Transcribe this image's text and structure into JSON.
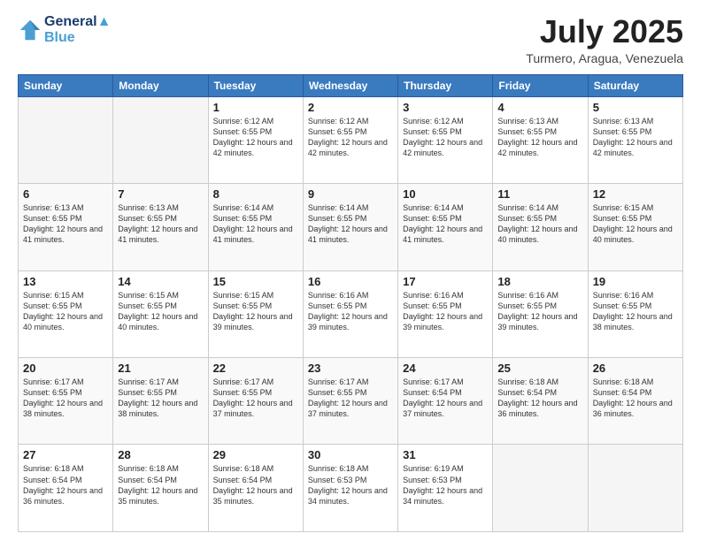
{
  "logo": {
    "line1": "General",
    "line2": "Blue"
  },
  "title": "July 2025",
  "location": "Turmero, Aragua, Venezuela",
  "weekdays": [
    "Sunday",
    "Monday",
    "Tuesday",
    "Wednesday",
    "Thursday",
    "Friday",
    "Saturday"
  ],
  "weeks": [
    [
      {
        "day": "",
        "info": ""
      },
      {
        "day": "",
        "info": ""
      },
      {
        "day": "1",
        "info": "Sunrise: 6:12 AM\nSunset: 6:55 PM\nDaylight: 12 hours and 42 minutes."
      },
      {
        "day": "2",
        "info": "Sunrise: 6:12 AM\nSunset: 6:55 PM\nDaylight: 12 hours and 42 minutes."
      },
      {
        "day": "3",
        "info": "Sunrise: 6:12 AM\nSunset: 6:55 PM\nDaylight: 12 hours and 42 minutes."
      },
      {
        "day": "4",
        "info": "Sunrise: 6:13 AM\nSunset: 6:55 PM\nDaylight: 12 hours and 42 minutes."
      },
      {
        "day": "5",
        "info": "Sunrise: 6:13 AM\nSunset: 6:55 PM\nDaylight: 12 hours and 42 minutes."
      }
    ],
    [
      {
        "day": "6",
        "info": "Sunrise: 6:13 AM\nSunset: 6:55 PM\nDaylight: 12 hours and 41 minutes."
      },
      {
        "day": "7",
        "info": "Sunrise: 6:13 AM\nSunset: 6:55 PM\nDaylight: 12 hours and 41 minutes."
      },
      {
        "day": "8",
        "info": "Sunrise: 6:14 AM\nSunset: 6:55 PM\nDaylight: 12 hours and 41 minutes."
      },
      {
        "day": "9",
        "info": "Sunrise: 6:14 AM\nSunset: 6:55 PM\nDaylight: 12 hours and 41 minutes."
      },
      {
        "day": "10",
        "info": "Sunrise: 6:14 AM\nSunset: 6:55 PM\nDaylight: 12 hours and 41 minutes."
      },
      {
        "day": "11",
        "info": "Sunrise: 6:14 AM\nSunset: 6:55 PM\nDaylight: 12 hours and 40 minutes."
      },
      {
        "day": "12",
        "info": "Sunrise: 6:15 AM\nSunset: 6:55 PM\nDaylight: 12 hours and 40 minutes."
      }
    ],
    [
      {
        "day": "13",
        "info": "Sunrise: 6:15 AM\nSunset: 6:55 PM\nDaylight: 12 hours and 40 minutes."
      },
      {
        "day": "14",
        "info": "Sunrise: 6:15 AM\nSunset: 6:55 PM\nDaylight: 12 hours and 40 minutes."
      },
      {
        "day": "15",
        "info": "Sunrise: 6:15 AM\nSunset: 6:55 PM\nDaylight: 12 hours and 39 minutes."
      },
      {
        "day": "16",
        "info": "Sunrise: 6:16 AM\nSunset: 6:55 PM\nDaylight: 12 hours and 39 minutes."
      },
      {
        "day": "17",
        "info": "Sunrise: 6:16 AM\nSunset: 6:55 PM\nDaylight: 12 hours and 39 minutes."
      },
      {
        "day": "18",
        "info": "Sunrise: 6:16 AM\nSunset: 6:55 PM\nDaylight: 12 hours and 39 minutes."
      },
      {
        "day": "19",
        "info": "Sunrise: 6:16 AM\nSunset: 6:55 PM\nDaylight: 12 hours and 38 minutes."
      }
    ],
    [
      {
        "day": "20",
        "info": "Sunrise: 6:17 AM\nSunset: 6:55 PM\nDaylight: 12 hours and 38 minutes."
      },
      {
        "day": "21",
        "info": "Sunrise: 6:17 AM\nSunset: 6:55 PM\nDaylight: 12 hours and 38 minutes."
      },
      {
        "day": "22",
        "info": "Sunrise: 6:17 AM\nSunset: 6:55 PM\nDaylight: 12 hours and 37 minutes."
      },
      {
        "day": "23",
        "info": "Sunrise: 6:17 AM\nSunset: 6:55 PM\nDaylight: 12 hours and 37 minutes."
      },
      {
        "day": "24",
        "info": "Sunrise: 6:17 AM\nSunset: 6:54 PM\nDaylight: 12 hours and 37 minutes."
      },
      {
        "day": "25",
        "info": "Sunrise: 6:18 AM\nSunset: 6:54 PM\nDaylight: 12 hours and 36 minutes."
      },
      {
        "day": "26",
        "info": "Sunrise: 6:18 AM\nSunset: 6:54 PM\nDaylight: 12 hours and 36 minutes."
      }
    ],
    [
      {
        "day": "27",
        "info": "Sunrise: 6:18 AM\nSunset: 6:54 PM\nDaylight: 12 hours and 36 minutes."
      },
      {
        "day": "28",
        "info": "Sunrise: 6:18 AM\nSunset: 6:54 PM\nDaylight: 12 hours and 35 minutes."
      },
      {
        "day": "29",
        "info": "Sunrise: 6:18 AM\nSunset: 6:54 PM\nDaylight: 12 hours and 35 minutes."
      },
      {
        "day": "30",
        "info": "Sunrise: 6:18 AM\nSunset: 6:53 PM\nDaylight: 12 hours and 34 minutes."
      },
      {
        "day": "31",
        "info": "Sunrise: 6:19 AM\nSunset: 6:53 PM\nDaylight: 12 hours and 34 minutes."
      },
      {
        "day": "",
        "info": ""
      },
      {
        "day": "",
        "info": ""
      }
    ]
  ]
}
